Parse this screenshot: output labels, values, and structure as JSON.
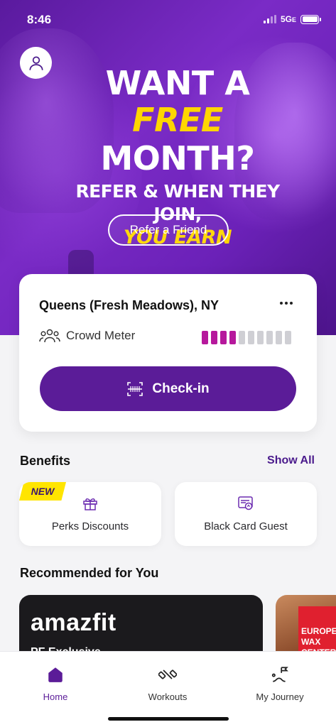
{
  "status": {
    "time": "8:46",
    "network": "5G",
    "network_suffix": "E"
  },
  "hero": {
    "line1": "WANT A",
    "line2_highlight": "FREE",
    "line2_rest": " MONTH?",
    "line3": "REFER & WHEN THEY JOIN,",
    "line4": "YOU EARN",
    "refer_button": "Refer a Friend"
  },
  "gym": {
    "name": "Queens (Fresh Meadows), NY",
    "crowd_label": "Crowd Meter",
    "crowd_level": 4,
    "crowd_max": 10,
    "checkin_label": "Check-in"
  },
  "benefits": {
    "title": "Benefits",
    "show_all": "Show All",
    "items": [
      {
        "label": "Perks Discounts",
        "badge": "NEW",
        "icon": "gift-icon"
      },
      {
        "label": "Black Card Guest",
        "icon": "guest-pass-icon"
      }
    ]
  },
  "recommended": {
    "title": "Recommended for You",
    "cards": [
      {
        "brand": "amazfit",
        "subtitle": "PF Exclusive"
      },
      {
        "brand": "EUROPEAN WAX CENTER"
      }
    ]
  },
  "tabs": [
    {
      "label": "Home",
      "icon": "home-icon",
      "active": true
    },
    {
      "label": "Workouts",
      "icon": "dumbbell-icon",
      "active": false
    },
    {
      "label": "My Journey",
      "icon": "journey-icon",
      "active": false
    }
  ],
  "colors": {
    "brand_purple": "#5b1c98",
    "accent_yellow": "#ffd600",
    "crowd_on": "#b6189c"
  }
}
